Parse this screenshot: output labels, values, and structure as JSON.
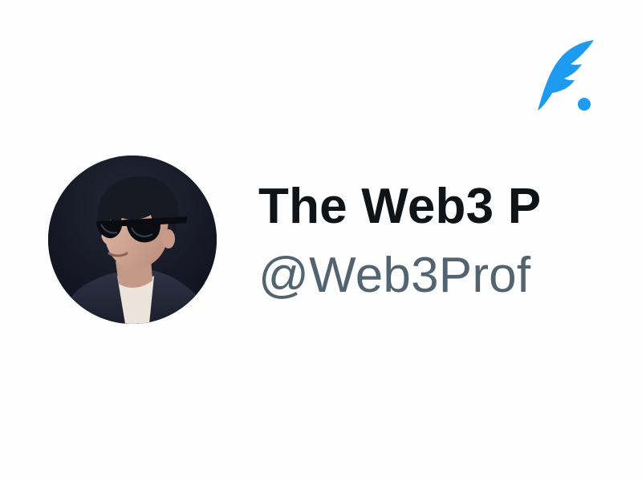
{
  "brand": {
    "icon": "quill-pen-icon",
    "accent_color": "#1d9bf0"
  },
  "profile": {
    "avatar_icon": "avatar",
    "display_name": "The Web3 P",
    "handle": "@Web3Prof"
  },
  "colors": {
    "background": "#fefefe",
    "name_text": "#0f1419",
    "handle_text": "#536471"
  }
}
